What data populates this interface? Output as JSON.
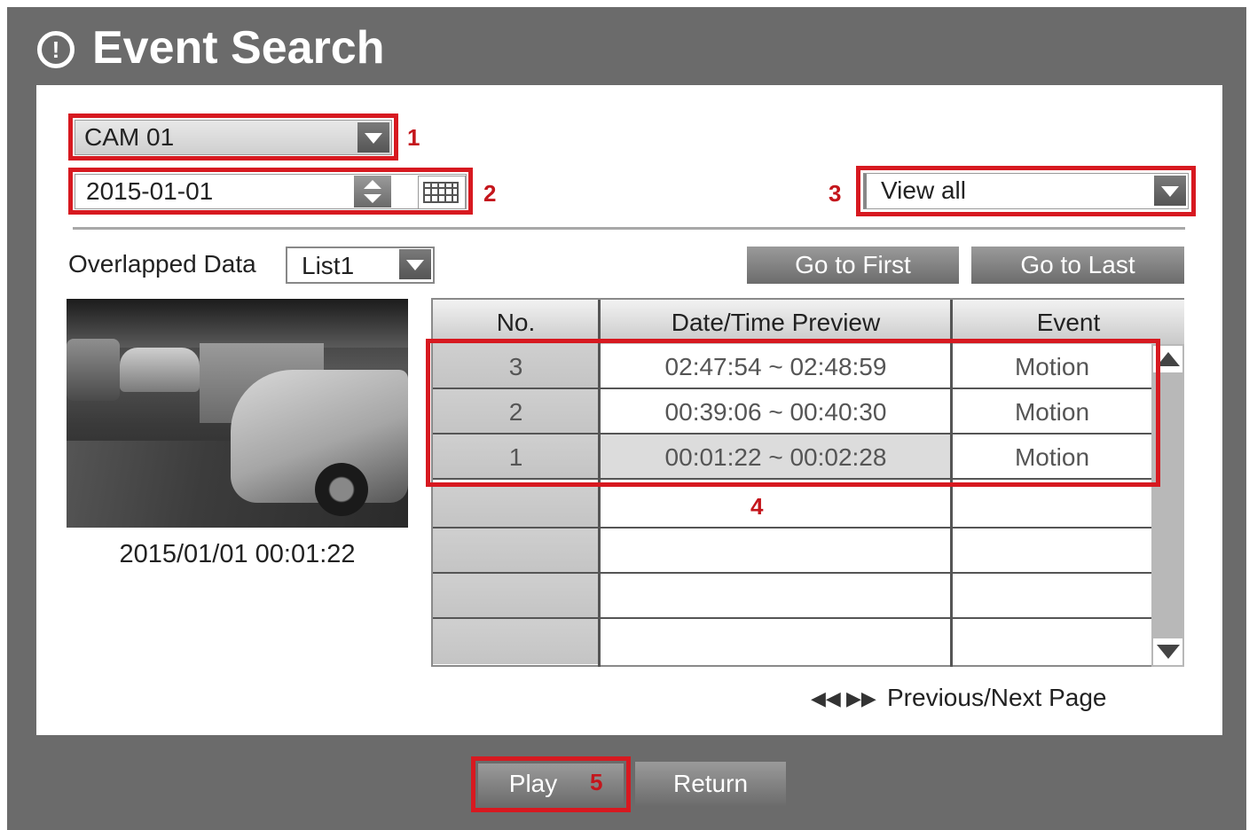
{
  "window": {
    "title": "Event Search",
    "title_icon": "alert-circle-icon"
  },
  "camera_select": {
    "value": "CAM 01",
    "callout": "1"
  },
  "date_field": {
    "value": "2015-01-01",
    "callout": "2"
  },
  "view_filter": {
    "value": "View all",
    "callout": "3"
  },
  "overlapped": {
    "label": "Overlapped Data",
    "value": "List1"
  },
  "nav_buttons": {
    "first": "Go to First",
    "last": "Go to Last"
  },
  "preview": {
    "timestamp": "2015/01/01  00:01:22"
  },
  "table": {
    "columns": [
      "No.",
      "Date/Time Preview",
      "Event"
    ],
    "rows": [
      {
        "no": "3",
        "time": "02:47:54 ~ 02:48:59",
        "event": "Motion"
      },
      {
        "no": "2",
        "time": "00:39:06 ~ 00:40:30",
        "event": "Motion"
      },
      {
        "no": "1",
        "time": "00:01:22 ~ 00:02:28",
        "event": "Motion"
      },
      {
        "no": "",
        "time": "",
        "event": ""
      },
      {
        "no": "",
        "time": "",
        "event": ""
      },
      {
        "no": "",
        "time": "",
        "event": ""
      },
      {
        "no": "",
        "time": "",
        "event": ""
      }
    ],
    "callout": "4"
  },
  "pager": {
    "label": "Previous/Next Page",
    "icons": "◀◀ ▶▶"
  },
  "footer": {
    "play": "Play",
    "play_callout": "5",
    "return": "Return"
  },
  "colors": {
    "highlight": "#d71920",
    "frame": "#6b6b6b",
    "button": "#7a7a7a"
  }
}
